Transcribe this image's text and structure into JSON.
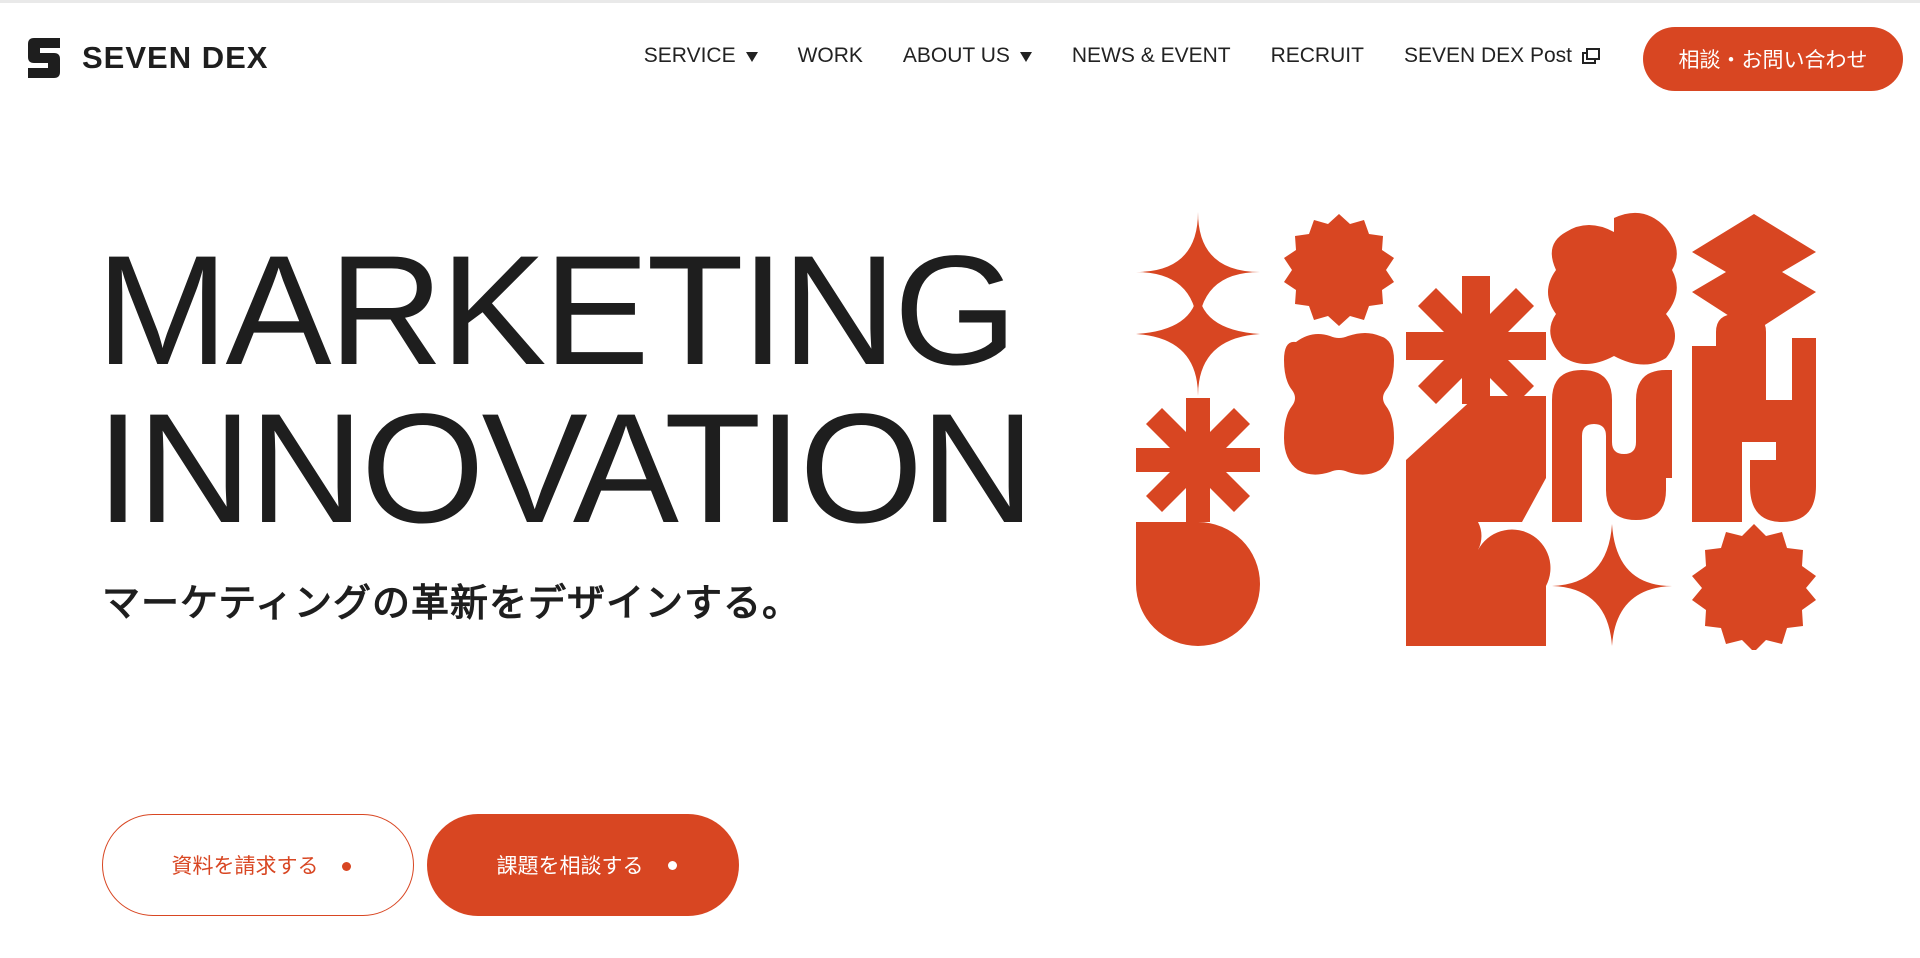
{
  "brand": {
    "name": "SEVEN DEX",
    "accent": "#d84622",
    "text": "#1e1e1e"
  },
  "nav": {
    "items": [
      {
        "label": "SERVICE",
        "dropdown": true
      },
      {
        "label": "WORK",
        "dropdown": false
      },
      {
        "label": "ABOUT US",
        "dropdown": true
      },
      {
        "label": "NEWS & EVENT",
        "dropdown": false
      },
      {
        "label": "RECRUIT",
        "dropdown": false
      },
      {
        "label": "SEVEN DEX Post",
        "dropdown": false,
        "external": true
      }
    ],
    "cta_label": "相談・お問い合わせ"
  },
  "hero": {
    "title_line1": "MARKETING",
    "title_line2": "INNOVATION",
    "subtitle": "マーケティングの革新をデザインする。"
  },
  "buttons": {
    "request_docs": "資料を請求する",
    "consult": "課題を相談する"
  }
}
